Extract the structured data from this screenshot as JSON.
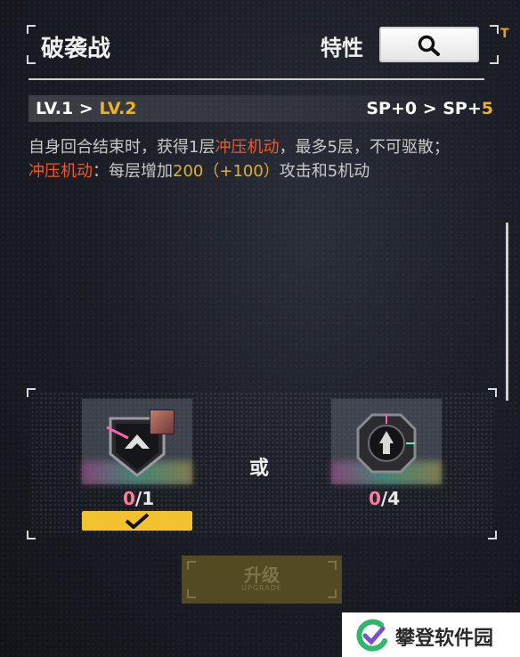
{
  "header": {
    "title": "破袭战",
    "trait_label": "特性",
    "t_mark": "T"
  },
  "level": {
    "from": "LV.1",
    "arrow": " > ",
    "to": "LV.2",
    "sp_from": "SP+0",
    "sp_arrow": " > SP+",
    "sp_to": "5"
  },
  "description": {
    "line1_a": "自身回合结束时，获得1层",
    "line1_keyword": "冲压机动",
    "line1_b": "，最多5层，不可驱散；",
    "line2_keyword": "冲压机动",
    "line2_a": "：每层增加",
    "line2_value": "200（+100）",
    "line2_b": "攻击和5机动"
  },
  "materials": {
    "or_label": "或",
    "items": [
      {
        "have": "0",
        "need": "/1",
        "icon": "emblem-material-icon"
      },
      {
        "have": "0",
        "need": "/4",
        "icon": "hex-core-material-icon"
      }
    ]
  },
  "upgrade": {
    "label": "升级",
    "sub": "UPGRADE"
  },
  "watermark": {
    "text": "攀登软件园"
  },
  "colors": {
    "accent_orange": "#f05a24",
    "accent_gold": "#f0b020",
    "check_bar": "#f2c230",
    "count_pink": "#ff7a9c"
  }
}
